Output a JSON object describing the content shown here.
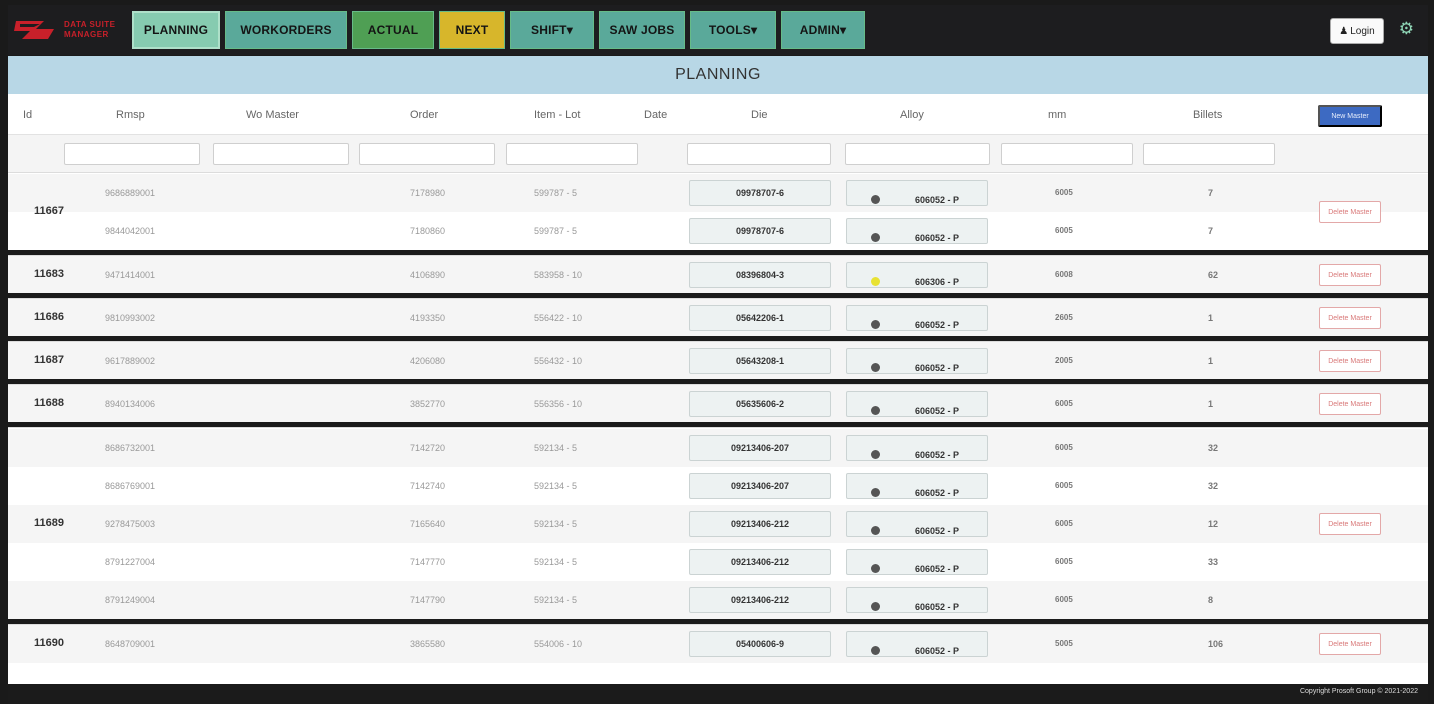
{
  "logo": {
    "line1": "DATA SUITE",
    "line2": "MANAGER"
  },
  "nav": [
    {
      "label": "PLANNING",
      "style": "active"
    },
    {
      "label": "WORKORDERS",
      "style": "teal"
    },
    {
      "label": "ACTUAL",
      "style": "green"
    },
    {
      "label": "NEXT",
      "style": "yellow"
    },
    {
      "label": "SHIFT▾",
      "style": "teal"
    },
    {
      "label": "SAW JOBS",
      "style": "teal"
    },
    {
      "label": "TOOLS▾",
      "style": "teal"
    },
    {
      "label": "ADMIN▾",
      "style": "teal"
    }
  ],
  "login_label": "Login",
  "page_title": "PLANNING",
  "columns": [
    "Id",
    "Rmsp",
    "Wo Master",
    "Order",
    "Item - Lot",
    "Date",
    "Die",
    "Alloy",
    "mm",
    "Billets"
  ],
  "new_master_label": "New Master",
  "delete_label": "Delete Master",
  "groups": [
    {
      "id": "11667",
      "rows": [
        {
          "rmsp": "9686889001",
          "order": "7178980",
          "item_lot": "599787 - 5",
          "die": "09978707-6",
          "alloy": "606052 - P",
          "dot": "dark",
          "mm": "6005",
          "billets": "7"
        },
        {
          "rmsp": "9844042001",
          "order": "7180860",
          "item_lot": "599787 - 5",
          "die": "09978707-6",
          "alloy": "606052 - P",
          "dot": "dark",
          "mm": "6005",
          "billets": "7"
        }
      ]
    },
    {
      "id": "11683",
      "rows": [
        {
          "rmsp": "9471414001",
          "order": "4106890",
          "item_lot": "583958 - 10",
          "die": "08396804-3",
          "alloy": "606306 - P",
          "dot": "yellow",
          "mm": "6008",
          "billets": "62"
        }
      ]
    },
    {
      "id": "11686",
      "rows": [
        {
          "rmsp": "9810993002",
          "order": "4193350",
          "item_lot": "556422 - 10",
          "die": "05642206-1",
          "alloy": "606052 - P",
          "dot": "dark",
          "mm": "2605",
          "billets": "1"
        }
      ]
    },
    {
      "id": "11687",
      "rows": [
        {
          "rmsp": "9617889002",
          "order": "4206080",
          "item_lot": "556432 - 10",
          "die": "05643208-1",
          "alloy": "606052 - P",
          "dot": "dark",
          "mm": "2005",
          "billets": "1"
        }
      ]
    },
    {
      "id": "11688",
      "rows": [
        {
          "rmsp": "8940134006",
          "order": "3852770",
          "item_lot": "556356 - 10",
          "die": "05635606-2",
          "alloy": "606052 - P",
          "dot": "dark",
          "mm": "6005",
          "billets": "1"
        }
      ]
    },
    {
      "id": "11689",
      "rows": [
        {
          "rmsp": "8686732001",
          "order": "7142720",
          "item_lot": "592134 - 5",
          "die": "09213406-207",
          "alloy": "606052 - P",
          "dot": "dark",
          "mm": "6005",
          "billets": "32"
        },
        {
          "rmsp": "8686769001",
          "order": "7142740",
          "item_lot": "592134 - 5",
          "die": "09213406-207",
          "alloy": "606052 - P",
          "dot": "dark",
          "mm": "6005",
          "billets": "32"
        },
        {
          "rmsp": "9278475003",
          "order": "7165640",
          "item_lot": "592134 - 5",
          "die": "09213406-212",
          "alloy": "606052 - P",
          "dot": "dark",
          "mm": "6005",
          "billets": "12"
        },
        {
          "rmsp": "8791227004",
          "order": "7147770",
          "item_lot": "592134 - 5",
          "die": "09213406-212",
          "alloy": "606052 - P",
          "dot": "dark",
          "mm": "6005",
          "billets": "33"
        },
        {
          "rmsp": "8791249004",
          "order": "7147790",
          "item_lot": "592134 - 5",
          "die": "09213406-212",
          "alloy": "606052 - P",
          "dot": "dark",
          "mm": "6005",
          "billets": "8"
        }
      ]
    },
    {
      "id": "11690",
      "rows": [
        {
          "rmsp": "8648709001",
          "order": "3865580",
          "item_lot": "554006 - 10",
          "die": "05400606-9",
          "alloy": "606052 - P",
          "dot": "dark",
          "mm": "5005",
          "billets": "106"
        }
      ]
    }
  ],
  "copyright": "Copyright Prosoft Group © 2021-2022",
  "colors": {
    "nav_bg": "#1d1d1f",
    "title_bar": "#b8d7e6",
    "new_master": "#3d6ac2",
    "delete_border": "#e3a8a8",
    "alloy_yellow": "#e8e233"
  }
}
